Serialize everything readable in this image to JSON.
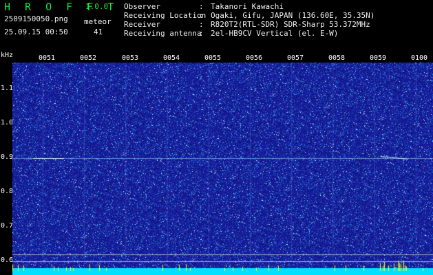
{
  "app": {
    "title": "H R O F F T",
    "version": "1.0.0"
  },
  "file": {
    "name": "2509150050.png",
    "datetime": "25.09.15 00:50"
  },
  "meteor": {
    "label": "meteor",
    "count": "41"
  },
  "info": [
    {
      "label": "Observer",
      "sep": ":",
      "value": "Takanori Kawachi"
    },
    {
      "label": "Receiving Location",
      "sep": ":",
      "value": "Ogaki, Gifu, JAPAN (136.60E, 35.35N)"
    },
    {
      "label": "Receiver",
      "sep": ":",
      "value": "R820T2(RTL-SDR) SDR-Sharp 53.372MHz"
    },
    {
      "label": "Receiving antenna",
      "sep": ":",
      "value": "2el-HB9CV Vertical (el. E-W)"
    }
  ],
  "axis": {
    "unit": "kHz",
    "minute_labels": [
      "0051",
      "0052",
      "0053",
      "0054",
      "0055",
      "0056",
      "0057",
      "0058",
      "0059",
      "0100"
    ],
    "freq_labels": [
      "1.1",
      "1.0",
      "0.9",
      "0.8",
      "0.7",
      "0.6"
    ]
  },
  "colors": {
    "title_green": "#19e63a",
    "plot_blue": "#1a1ea0",
    "spectrum_cyan": "#00e0ff",
    "spike_yellow": "#ffff00"
  }
}
